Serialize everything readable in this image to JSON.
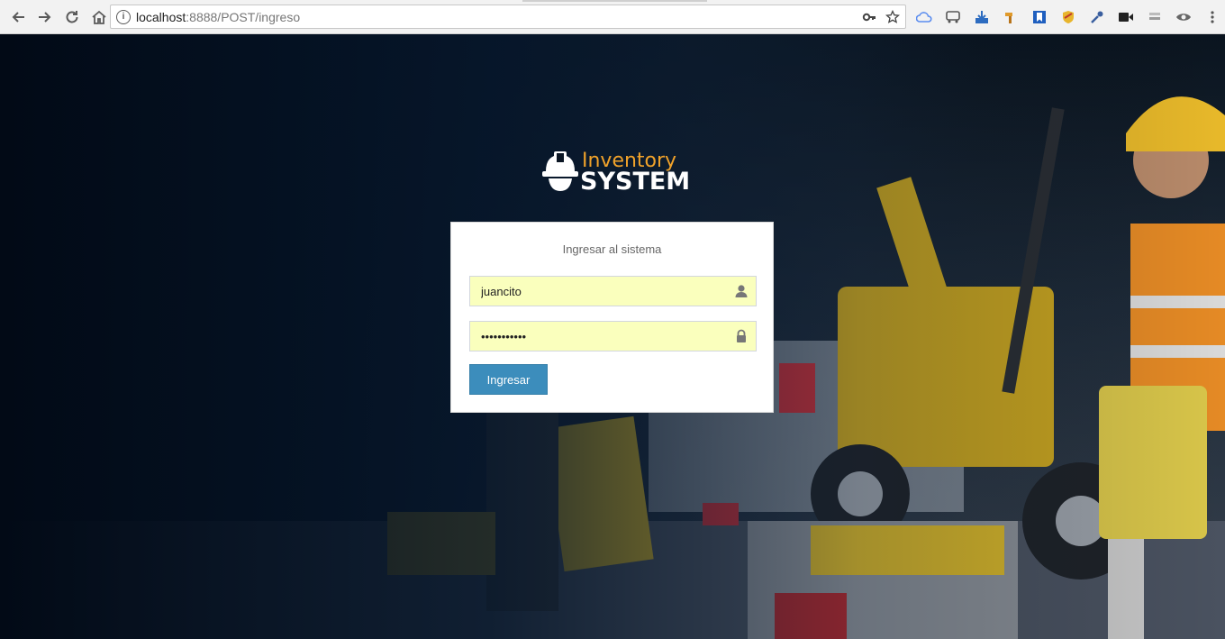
{
  "browser": {
    "url_host": "localhost",
    "url_path": ":8888/POST/ingreso",
    "nav_icons": [
      "back-icon",
      "forward-icon",
      "reload-icon",
      "home-icon"
    ],
    "omnibox_icons": [
      "info-icon",
      "key-icon",
      "star-icon"
    ],
    "extensions": [
      {
        "name": "cloud-extension-icon",
        "color": "#5b8def"
      },
      {
        "name": "bus-extension-icon",
        "color": "#555555"
      },
      {
        "name": "download-extension-icon",
        "color": "#2d6cc0"
      },
      {
        "name": "tag-extension-icon",
        "color": "#e09a2b"
      },
      {
        "name": "bookmark-extension-icon",
        "color": "#1f5fbf"
      },
      {
        "name": "shield-extension-icon",
        "color": "#e8b52c"
      },
      {
        "name": "eyedropper-extension-icon",
        "color": "#3a5f9f"
      },
      {
        "name": "video-extension-icon",
        "color": "#222222"
      },
      {
        "name": "seo-extension-icon",
        "color": "#9a9a9a"
      },
      {
        "name": "eye-extension-icon",
        "color": "#666666"
      },
      {
        "name": "menu-icon",
        "color": "#555555"
      }
    ]
  },
  "logo": {
    "line1": "Inventory",
    "line2": "SYSTEM"
  },
  "login": {
    "message": "Ingresar al sistema",
    "username_value": "juancito",
    "password_value": "•••••••••••",
    "submit_label": "Ingresar"
  },
  "colors": {
    "button": "#3c8dbc",
    "autofill": "#faffbd",
    "logo_orange": "#f0a22a"
  }
}
